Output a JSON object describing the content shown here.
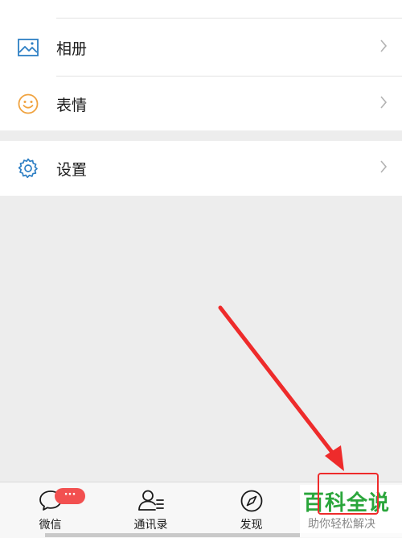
{
  "menu": {
    "album_label": "相册",
    "sticker_label": "表情",
    "settings_label": "设置"
  },
  "tabbar": {
    "chats_label": "微信",
    "chats_badge": "···",
    "contacts_label": "通讯录",
    "discover_label": "发现"
  },
  "watermark": {
    "title": "百科全说",
    "subtitle": "助你轻松解决"
  },
  "colors": {
    "accent_blue": "#2e7fc4",
    "sticker_orange": "#f0a340",
    "badge_red": "#f25050",
    "annotation_red": "#ee2b2b",
    "watermark_green": "#2aa63b"
  }
}
